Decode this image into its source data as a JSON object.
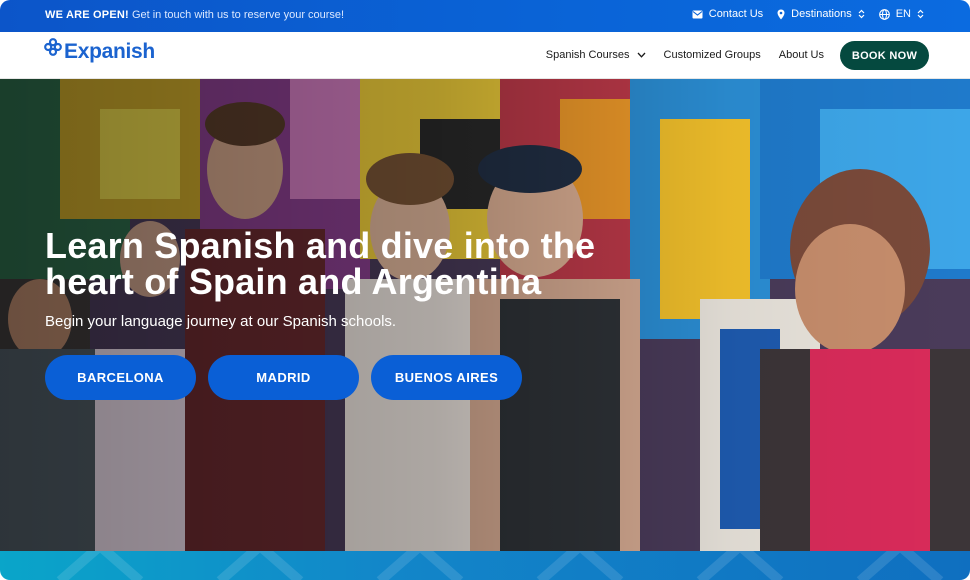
{
  "topbar": {
    "announce_bold": "WE ARE OPEN!",
    "announce_text": "Get in touch with us to reserve your course!",
    "contact_label": "Contact Us",
    "destinations_label": "Destinations",
    "language_label": "EN"
  },
  "header": {
    "logo_text": "Expanish",
    "nav": [
      {
        "label": "Spanish Courses"
      },
      {
        "label": "Customized Groups"
      },
      {
        "label": "About Us"
      }
    ],
    "book_label": "BOOK NOW"
  },
  "hero": {
    "title_line1": "Learn Spanish and dive into the",
    "title_line2": "heart of Spain and Argentina",
    "subtitle": "Begin your language journey at our Spanish schools.",
    "cities": [
      {
        "label": "BARCELONA"
      },
      {
        "label": "MADRID"
      },
      {
        "label": "BUENOS AIRES"
      }
    ]
  },
  "colors": {
    "topbar_blue": "#0a63d6",
    "brand_blue": "#1b63cf",
    "book_green": "#05493f",
    "city_button_blue": "#0a5fd6"
  },
  "icons": [
    "mail-icon",
    "location-pin-icon",
    "sort-arrows-icon",
    "globe-icon",
    "chevron-down-icon",
    "expanish-logo-mark"
  ]
}
